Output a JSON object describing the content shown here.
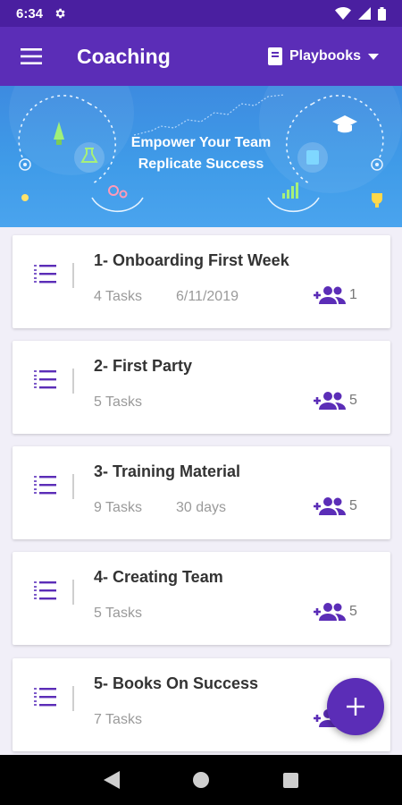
{
  "status": {
    "time": "6:34"
  },
  "app_bar": {
    "title": "Coaching",
    "playbooks_label": "Playbooks"
  },
  "banner": {
    "line1": "Empower Your Team",
    "line2": "Replicate Success"
  },
  "playbooks": [
    {
      "title": "1- Onboarding First Week",
      "tasks": "4 Tasks",
      "date": "6/11/2019",
      "members": "1"
    },
    {
      "title": "2- First Party",
      "tasks": "5 Tasks",
      "date": "",
      "members": "5"
    },
    {
      "title": "3- Training Material",
      "tasks": "9 Tasks",
      "date": "30 days",
      "members": "5"
    },
    {
      "title": "4- Creating Team",
      "tasks": "5 Tasks",
      "date": "",
      "members": "5"
    },
    {
      "title": "5- Books On Success",
      "tasks": "7 Tasks",
      "date": "",
      "members": ""
    }
  ],
  "colors": {
    "primary": "#5b2db7",
    "status_bar": "#4a1fa0",
    "banner": "#3f9be8",
    "list_bg": "#f1eff8"
  },
  "icons": {
    "menu": "menu-icon",
    "playbooks": "book-icon",
    "list": "list-icon",
    "members": "group-add-icon",
    "fab": "plus-icon"
  }
}
